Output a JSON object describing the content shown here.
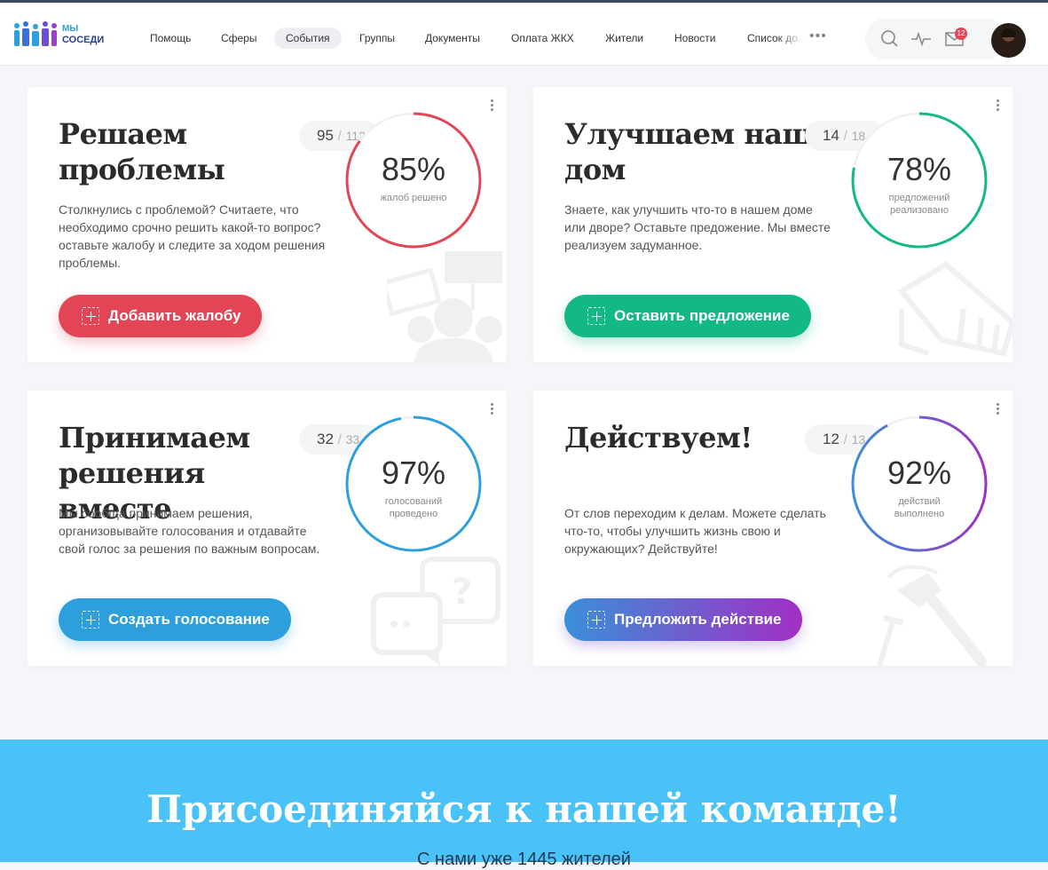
{
  "brand": {
    "line1": "МЫ",
    "line2": "СОСЕДИ"
  },
  "nav": {
    "items": [
      "Помощь",
      "Сферы",
      "События",
      "Группы",
      "Документы",
      "Оплата ЖКХ",
      "Жители",
      "Новости",
      "Список до..."
    ],
    "active": "События",
    "more_icon": "more-horizontal-icon"
  },
  "tools": {
    "icons": [
      "search-icon",
      "activity-icon",
      "mail-icon"
    ],
    "mail_badge": "12"
  },
  "cards": [
    {
      "title": "Решаем проблемы",
      "desc": "Столкнулись с проблемой? Считаете, что необходимо срочно решить какой-то вопрос? оставьте жалобу и следите за ходом решения проблемы.",
      "done": "95",
      "total": "112",
      "sep": "/",
      "percent": "85%",
      "percent_value": 85,
      "label": "жалоб решено",
      "button": "Добавить жалобу",
      "color": "#e34556",
      "illustration": "protest-people-icon"
    },
    {
      "title": "Улучшаем наш дом",
      "desc": "Знаете, как улучшить что-то в нашем доме или дворе? Оставьте предожение. Мы вместе реализуем задуманное.",
      "done": "14",
      "total": "18",
      "sep": "/",
      "percent": "78%",
      "percent_value": 78,
      "label": "предложений реализовано",
      "button": "Оставить предложение",
      "color": "#12b886",
      "illustration": "megaphone-icon"
    },
    {
      "title": "Принимаем решения вместе",
      "desc": "Мы сообща принимаем решения, организовывайте голосования и отдавайте свой голос за решения по важным вопросам.",
      "done": "32",
      "total": "33",
      "sep": "/",
      "percent": "97%",
      "percent_value": 97,
      "label": "голосований проведено",
      "button": "Создать голосование",
      "color": "#2d9fdc",
      "illustration": "chat-question-icon"
    },
    {
      "title": "Действуем!",
      "desc": "От слов переходим к делам. Можете сделать что-то, чтобы улучшить жизнь свою и окружающих? Действуйте!",
      "done": "12",
      "total": "13",
      "sep": "/",
      "percent": "92%",
      "percent_value": 92,
      "label": "действий выполнено",
      "button": "Предложить действие",
      "color_from": "#3a8fd9",
      "color_to": "#a12fc4",
      "illustration": "hammer-nail-icon"
    }
  ],
  "join": {
    "title": "Присоединяйся к нашей команде!",
    "subtitle": "С нами уже 1445 жителей"
  }
}
